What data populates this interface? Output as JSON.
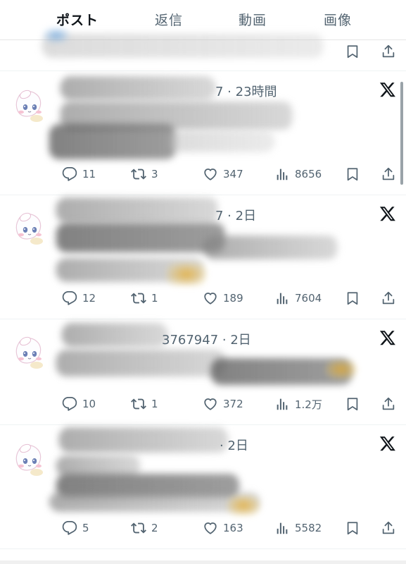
{
  "tabs": [
    {
      "label": "ポスト",
      "active": true
    },
    {
      "label": "返信",
      "active": false
    },
    {
      "label": "動画",
      "active": false
    },
    {
      "label": "画像",
      "active": false
    }
  ],
  "icons": {
    "reply": "reply-icon",
    "repost": "repost-icon",
    "like": "heart-icon",
    "views": "views-icon",
    "bookmark": "bookmark-icon",
    "share": "share-icon",
    "platform": "x-logo-icon",
    "avatar": "cinnamoroll-avatar"
  },
  "colors": {
    "text": "#0f1419",
    "muted": "#536471",
    "divider": "#eff3f4"
  },
  "posts": [
    {
      "meta": "7 · 23時間",
      "replies": "11",
      "reposts": "3",
      "likes": "347",
      "views": "8656"
    },
    {
      "meta": "7 · 2日",
      "replies": "12",
      "reposts": "1",
      "likes": "189",
      "views": "7604"
    },
    {
      "meta": "3767947 · 2日",
      "replies": "10",
      "reposts": "1",
      "likes": "372",
      "views": "1.2万"
    },
    {
      "meta": "· 2日",
      "replies": "5",
      "reposts": "2",
      "likes": "163",
      "views": "5582"
    }
  ]
}
